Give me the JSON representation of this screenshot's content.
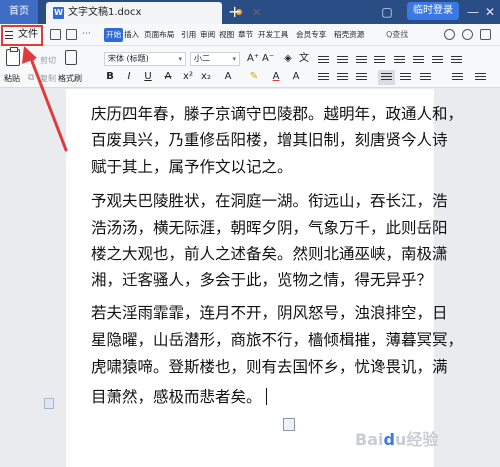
{
  "titlebar": {
    "home_tab": "首页",
    "doc_icon": "W",
    "doc_name": "文字文稿1.docx",
    "new_tab": "+",
    "login_button": "临时登录",
    "minimize": "—",
    "maximize": "▢",
    "close": "✕"
  },
  "menubar": {
    "file_label": "文件",
    "items": [
      "开始",
      "插入",
      "页面布局",
      "引用",
      "审阅",
      "视图",
      "章节",
      "开发工具",
      "会员专享",
      "稻壳资源"
    ],
    "search_label": "Q查找"
  },
  "ribbon": {
    "paste": "粘贴",
    "cut": "剪切",
    "copy": "复制",
    "format_painter": "格式刷",
    "font_name": "宋体 (标题)",
    "font_size": "小二",
    "bold": "B",
    "italic": "I",
    "underline": "U",
    "strike": "A",
    "grow_font": "A⁺",
    "shrink_font": "A⁻",
    "font_color": "A"
  },
  "document": {
    "lines": [
      "庆历四年春，滕子京谪守巴陵郡。越明年，政通人和，",
      "百废具兴，乃重修岳阳楼，增其旧制，刻唐贤今人诗",
      "赋于其上，属予作文以记之。",
      "予观夫巴陵胜状，在洞庭一湖。衔远山，吞长江，浩",
      "浩汤汤，横无际涯，朝晖夕阴，气象万千，此则岳阳",
      "楼之大观也，前人之述备矣。然则北通巫峡，南极潇",
      "湘，迁客骚人，多会于此，览物之情，得无异乎？",
      "若夫淫雨霏霏，连月不开，阴风怒号，浊浪排空，日",
      "星隐曜，山岳潜形，商旅不行，樯倾楫摧，薄暮冥冥，",
      "虎啸猿啼。登斯楼也，则有去国怀乡，忧谗畏讥，满",
      "目萧然，感极而悲者矣。"
    ]
  },
  "watermark": "Baidu经验",
  "colors": {
    "titlebar_bg": "#2a4d86",
    "accent": "#2f6bd6",
    "highlight": "#e03a3a"
  }
}
